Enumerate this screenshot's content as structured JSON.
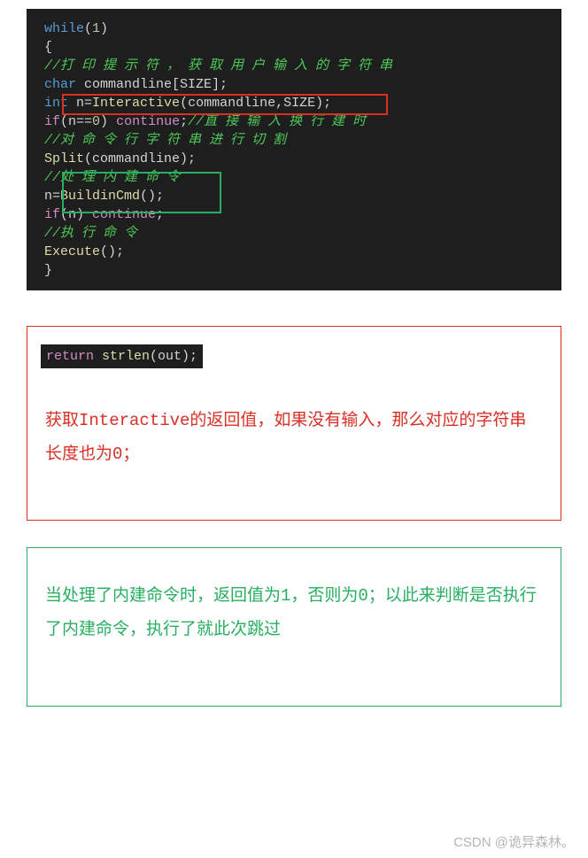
{
  "code1": {
    "l1_a": "while",
    "l1_b": "(",
    "l1_c": "1",
    "l1_d": ")",
    "l2": "{",
    "l3": "//打 印 提 示 符 ， 获 取 用 户 输 入 的 字 符 串",
    "l4_a": "char",
    "l4_b": " commandline[SIZE];",
    "l5_a": "int",
    "l5_b": " n=",
    "l5_c": "Interactive",
    "l5_d": "(commandline,SIZE);",
    "l6_a": "if",
    "l6_b": "(n==",
    "l6_c": "0",
    "l6_d": ") ",
    "l6_e": "continue",
    "l6_f": ";",
    "l6_g": "//直 接 输 入 换 行 建 时",
    "l7": "//对 命 令 行 字 符 串 进 行 切 割",
    "l8_a": "Split",
    "l8_b": "(commandline);",
    "l9": "//处 理 内 建 命 令",
    "l10_a": "n=",
    "l10_b": "BuildinCmd",
    "l10_c": "();",
    "l11_a": "if",
    "l11_b": "(n) ",
    "l11_c": "continue",
    "l11_d": ";",
    "l12": "//执 行 命 令",
    "l13_a": "Execute",
    "l13_b": "();",
    "l14": "}"
  },
  "inline": {
    "a": "return",
    "b": " ",
    "c": "strlen",
    "d": "(out);"
  },
  "note_red": "获取Interactive的返回值，如果没有输入，那么对应的字符串长度也为0；",
  "note_green": "当处理了内建命令时，返回值为1，否则为0；以此来判断是否执行了内建命令，执行了就此次跳过",
  "watermark": "CSDN @诡异森林。"
}
